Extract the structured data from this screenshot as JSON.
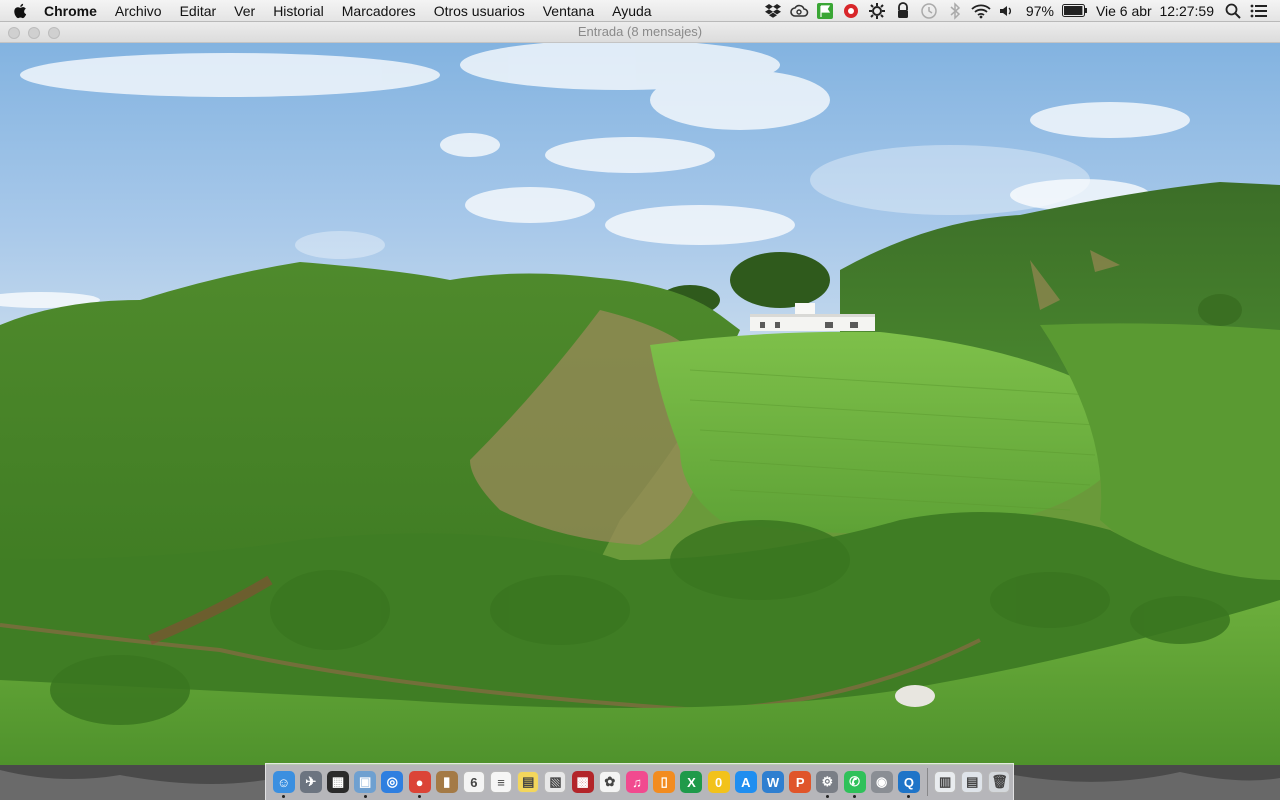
{
  "menubar": {
    "apple_icon": "apple-logo-icon",
    "app_name": "Chrome",
    "menus": [
      "Archivo",
      "Editar",
      "Ver",
      "Historial",
      "Marcadores",
      "Otros usuarios",
      "Ventana",
      "Ayuda"
    ],
    "status_icons": [
      "dropbox-icon",
      "creative-cloud-icon",
      "flag-icon",
      "rescue-icon",
      "gear-bug-icon",
      "vpn-lock-icon",
      "time-machine-icon",
      "bluetooth-icon",
      "wifi-icon",
      "volume-icon"
    ],
    "battery_percent": "97%",
    "battery_level": 0.97,
    "datetime": "Vie 6 abr  12:27:59",
    "right_icons": [
      "spotlight-search-icon",
      "notification-center-icon"
    ]
  },
  "window": {
    "title": "Entrada (8 mensajes)"
  },
  "desktop": {
    "wallpaper": "aerial-hillside-with-white-house"
  },
  "dock": {
    "apps": [
      {
        "name": "finder",
        "icon": "finder-icon",
        "running": true,
        "color": "#3b8fe0",
        "glyph": "☺"
      },
      {
        "name": "launchpad",
        "icon": "launchpad-icon",
        "running": false,
        "color": "#6c7480",
        "glyph": "✈"
      },
      {
        "name": "mission-control",
        "icon": "mission-control-icon",
        "running": false,
        "color": "#2b2b2b",
        "glyph": "▦"
      },
      {
        "name": "preview",
        "icon": "preview-icon",
        "running": true,
        "color": "#6fa0d0",
        "glyph": "▣"
      },
      {
        "name": "safari",
        "icon": "safari-icon",
        "running": false,
        "color": "#2f7fe0",
        "glyph": "◎"
      },
      {
        "name": "chrome",
        "icon": "chrome-icon",
        "running": true,
        "color": "#db4437",
        "glyph": "●"
      },
      {
        "name": "notefile",
        "icon": "notefile-icon",
        "running": false,
        "color": "#a47a46",
        "glyph": "▮"
      },
      {
        "name": "calendar",
        "icon": "calendar-icon",
        "running": false,
        "color": "#f4f4f4",
        "glyph": "6"
      },
      {
        "name": "reminders",
        "icon": "reminders-icon",
        "running": false,
        "color": "#f6f6f6",
        "glyph": "≡"
      },
      {
        "name": "notes",
        "icon": "notes-icon",
        "running": false,
        "color": "#f3d65c",
        "glyph": "▤"
      },
      {
        "name": "photo-browser",
        "icon": "photo-browser-icon",
        "running": false,
        "color": "#e8e8e8",
        "glyph": "▧"
      },
      {
        "name": "photo-booth",
        "icon": "photo-booth-icon",
        "running": false,
        "color": "#b3252a",
        "glyph": "▩"
      },
      {
        "name": "photos",
        "icon": "photos-icon",
        "running": false,
        "color": "#f4f4f4",
        "glyph": "✿"
      },
      {
        "name": "itunes",
        "icon": "itunes-icon",
        "running": false,
        "color": "#f14a8f",
        "glyph": "♫"
      },
      {
        "name": "ibooks",
        "icon": "ibooks-icon",
        "running": false,
        "color": "#f28c20",
        "glyph": "▯"
      },
      {
        "name": "excel",
        "icon": "excel-icon",
        "running": false,
        "color": "#1f9a4a",
        "glyph": "X"
      },
      {
        "name": "sticky-zero",
        "icon": "zero-app-icon",
        "running": false,
        "color": "#f2c21b",
        "glyph": "0"
      },
      {
        "name": "app-store",
        "icon": "app-store-icon",
        "running": false,
        "color": "#1f8ef0",
        "glyph": "A"
      },
      {
        "name": "word",
        "icon": "word-icon",
        "running": false,
        "color": "#2f7fd0",
        "glyph": "W"
      },
      {
        "name": "powerpoint",
        "icon": "powerpoint-icon",
        "running": false,
        "color": "#e0552a",
        "glyph": "P"
      },
      {
        "name": "system-preferences",
        "icon": "system-preferences-icon",
        "running": true,
        "color": "#7a7e86",
        "glyph": "⚙"
      },
      {
        "name": "whatsapp",
        "icon": "whatsapp-icon",
        "running": true,
        "color": "#2fc15a",
        "glyph": "✆"
      },
      {
        "name": "disk-utility",
        "icon": "disk-utility-icon",
        "running": false,
        "color": "#8a8e94",
        "glyph": "◉"
      },
      {
        "name": "quicktime",
        "icon": "quicktime-icon",
        "running": true,
        "color": "#1e74c8",
        "glyph": "Q"
      }
    ],
    "tail": [
      {
        "name": "document-file",
        "icon": "document-icon",
        "color": "#e9ecef",
        "glyph": "▥"
      },
      {
        "name": "downloads-stack",
        "icon": "downloads-stack-icon",
        "color": "#dfe4ea",
        "glyph": "▤"
      },
      {
        "name": "trash",
        "icon": "trash-icon",
        "color": "#d4d8dc",
        "glyph": "🗑"
      }
    ]
  }
}
